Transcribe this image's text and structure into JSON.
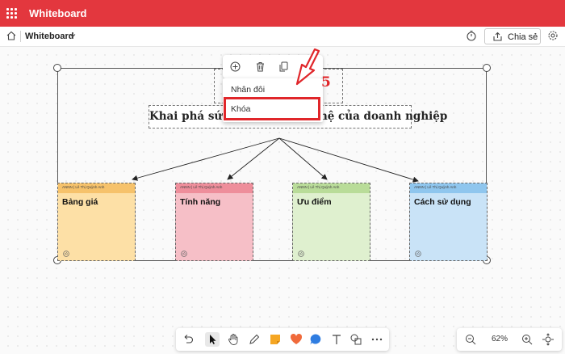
{
  "app": {
    "title": "Whiteboard"
  },
  "toolbar": {
    "board_name": "Whiteboard",
    "share_label": "Chia sẻ"
  },
  "canvas": {
    "heading": "Khai phá sức mạnh công nghệ của doanh nghiệp",
    "notes": [
      {
        "author": "ANNN | Lê Thị Quỳnh Anh",
        "title": "Bảng giá",
        "header_color": "#f6c26b",
        "body_color": "#fde0a6"
      },
      {
        "author": "ANNN | Lê Thị Quỳnh Anh",
        "title": "Tính năng",
        "header_color": "#ee8e9b",
        "body_color": "#f6bfc7"
      },
      {
        "author": "ANNN | Lê Thị Quỳnh Anh",
        "title": "Ưu điểm",
        "header_color": "#b9dc99",
        "body_color": "#dff0cf"
      },
      {
        "author": "ANNN | Lê Thị Quỳnh Anh",
        "title": "Cách sử dụng",
        "header_color": "#8fc6ee",
        "body_color": "#c9e3f7"
      }
    ]
  },
  "context_menu": {
    "icons": [
      "add-icon",
      "delete-icon",
      "copy-icon"
    ],
    "items": [
      "Nhân đôi",
      "Khóa"
    ]
  },
  "annotation": {
    "step_number": "5",
    "color": "#e0262a"
  },
  "bottom_toolbar": {
    "tools": [
      "undo-icon",
      "select-icon",
      "pan-icon",
      "pen-icon",
      "sticky-note-icon",
      "reaction-icon",
      "comment-icon",
      "text-icon",
      "shapes-icon",
      "more-icon"
    ]
  },
  "zoom": {
    "level": "62%"
  },
  "colors": {
    "brand": "#e3373e",
    "accent_red": "#e0262a"
  }
}
